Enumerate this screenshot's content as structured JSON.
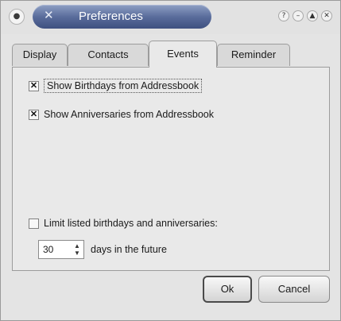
{
  "window": {
    "title": "Preferences",
    "title_icon": "app-x-icon",
    "menu_icon": "window-menu-icon",
    "buttons": [
      "help-icon",
      "minimize-icon",
      "maximize-icon",
      "close-icon"
    ]
  },
  "tabs": [
    {
      "label": "Display",
      "active": false
    },
    {
      "label": "Contacts",
      "active": false
    },
    {
      "label": "Events",
      "active": true
    },
    {
      "label": "Reminder",
      "active": false
    }
  ],
  "events": {
    "show_birthdays": {
      "label": "Show Birthdays from Addressbook",
      "checked": true
    },
    "show_anniversaries": {
      "label": "Show Anniversaries from Addressbook",
      "checked": true
    },
    "limit": {
      "label": "Limit listed birthdays and anniversaries:",
      "checked": false
    },
    "days": {
      "value": "30",
      "suffix": "days in the future"
    }
  },
  "dialog_buttons": {
    "ok": "Ok",
    "cancel": "Cancel"
  },
  "colors": {
    "title_bar_gradient_top": "#8fa0c4",
    "title_bar_gradient_bottom": "#3e5080",
    "window_bg": "#e4e4e4"
  }
}
